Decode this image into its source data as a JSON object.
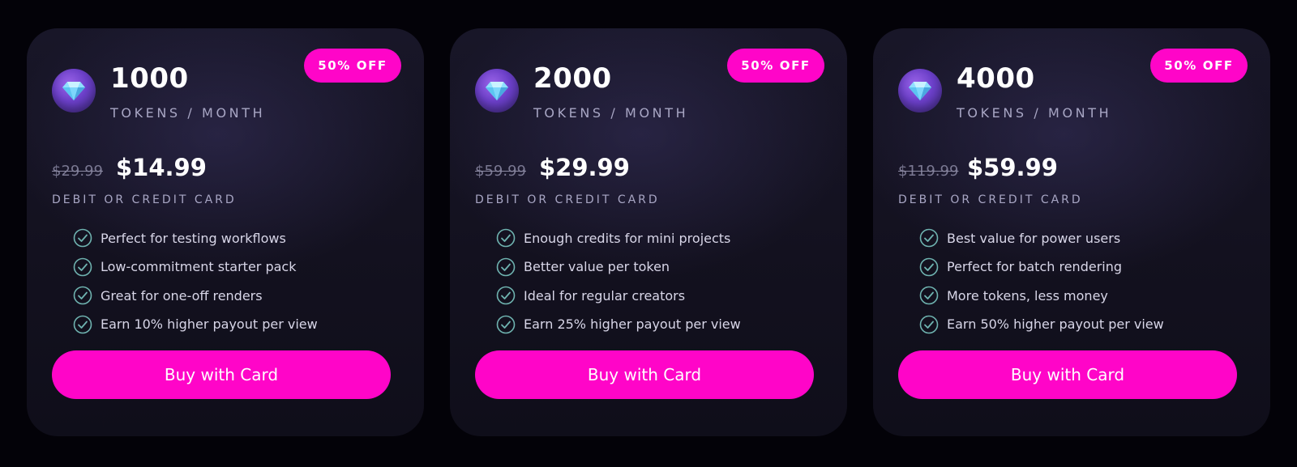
{
  "colors": {
    "background": "#030208",
    "card": "#15132a",
    "accent": "#ff05c8",
    "check": "#6fb3b0",
    "muted_text": "#a8a6c4"
  },
  "cards": [
    {
      "badge": "50% OFF",
      "icon": "diamond-icon",
      "amount": "1000",
      "unit": "TOKENS / MONTH",
      "old_price": "$29.99",
      "new_price": "$14.99",
      "payment_method": "DEBIT OR CREDIT CARD",
      "features": [
        "Perfect for testing workflows",
        "Low-commitment starter pack",
        "Great for one-off renders",
        "Earn 10% higher payout per view"
      ],
      "button": "Buy with Card"
    },
    {
      "badge": "50% OFF",
      "icon": "diamond-icon",
      "amount": "2000",
      "unit": "TOKENS / MONTH",
      "old_price": "$59.99",
      "new_price": "$29.99",
      "payment_method": "DEBIT OR CREDIT CARD",
      "features": [
        "Enough credits for mini projects",
        "Better value per token",
        "Ideal for regular creators",
        "Earn 25% higher payout per view"
      ],
      "button": "Buy with Card"
    },
    {
      "badge": "50% OFF",
      "icon": "diamond-icon",
      "amount": "4000",
      "unit": "TOKENS / MONTH",
      "old_price": "$119.99",
      "new_price": "$59.99",
      "payment_method": "DEBIT OR CREDIT CARD",
      "features": [
        "Best value for power users",
        "Perfect for batch rendering",
        "More tokens, less money",
        "Earn 50% higher payout per view"
      ],
      "button": "Buy with Card"
    }
  ]
}
